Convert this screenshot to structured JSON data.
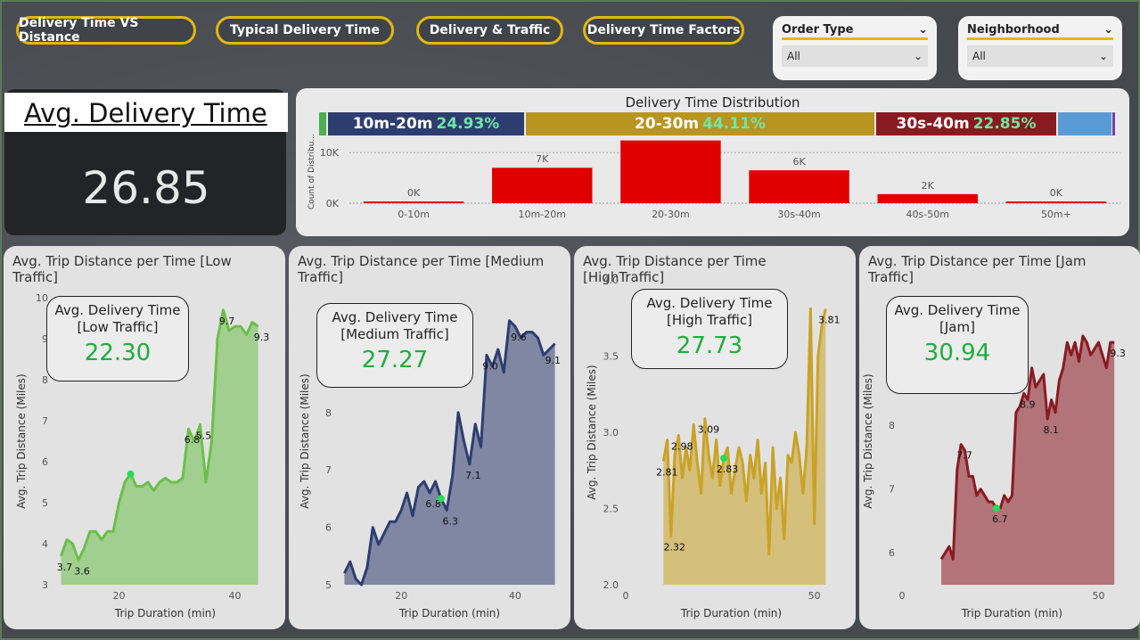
{
  "nav": {
    "btn1": "Delivery Time VS Distance",
    "btn2": "Typical Delivery Time",
    "btn3": "Delivery & Traffic",
    "btn4": "Delivery Time Factors"
  },
  "slicers": {
    "order_type": {
      "label": "Order Type",
      "value": "All"
    },
    "neighborhood": {
      "label": "Neighborhood",
      "value": "All"
    }
  },
  "kpi": {
    "label": "Avg. Delivery Time",
    "value": "26.85"
  },
  "distribution": {
    "title": "Delivery Time Distribution",
    "bands": [
      {
        "label": "10m-20m",
        "pct": "24.93%",
        "color": "#2e3d70"
      },
      {
        "label": "20-30m",
        "pct": "44.11%",
        "color": "#b8951f"
      },
      {
        "label": "30s-40m",
        "pct": "22.85%",
        "color": "#8a1a22"
      }
    ],
    "ylabel": "Count of Distribu...",
    "yticks": [
      "10K",
      "0K"
    ]
  },
  "panels": {
    "low": {
      "title": "Avg. Trip Distance per Time [Low Traffic]",
      "callout_label": "Avg. Delivery Time [Low Traffic]",
      "callout_value": "22.30"
    },
    "medium": {
      "title": "Avg. Trip Distance per Time [Medium Traffic]",
      "callout_label": "Avg. Delivery Time [Medium Traffic]",
      "callout_value": "27.27"
    },
    "high": {
      "title": "Avg. Trip Distance per Time [HighTraffic]",
      "callout_label": "Avg. Delivery Time [High Traffic]",
      "callout_value": "27.73"
    },
    "jam": {
      "title": "Avg. Trip Distance per Time [Jam Traffic]",
      "callout_label": "Avg. Delivery Time [Jam]",
      "callout_value": "30.94"
    }
  },
  "chart_data": [
    {
      "type": "bar",
      "title": "Delivery Time Distribution",
      "ylabel": "Count of Distribu...",
      "categories": [
        "0-10m",
        "10m-20m",
        "20-30m",
        "30s-40m",
        "40s-50m",
        "50m+"
      ],
      "values": [
        100,
        7000,
        12400,
        6500,
        1800,
        50
      ],
      "data_labels": [
        "0K",
        "7K",
        "",
        "6K",
        "2K",
        "0K"
      ],
      "ylim": [
        0,
        12500
      ],
      "color": "#e00000"
    },
    {
      "type": "area",
      "title": "Avg. Trip Distance per Time [Low Traffic]",
      "xlabel": "Trip Duration (min)",
      "ylabel": "Avg. Trip Distance (Miles)",
      "xlim": [
        9,
        47
      ],
      "ylim": [
        3,
        10
      ],
      "xticks": [
        20,
        40
      ],
      "yticks": [
        3,
        4,
        5,
        6,
        7,
        8,
        9,
        10
      ],
      "color": "#6cbf4a",
      "x": [
        10,
        11,
        12,
        13,
        14,
        15,
        16,
        17,
        18,
        19,
        20,
        21,
        22,
        23,
        24,
        25,
        26,
        27,
        28,
        29,
        30,
        31,
        32,
        33,
        34,
        35,
        36,
        37,
        38,
        39,
        40,
        41,
        42,
        43,
        44
      ],
      "y": [
        3.7,
        4.1,
        4.0,
        3.6,
        3.9,
        4.3,
        4.3,
        4.1,
        4.3,
        4.3,
        5.0,
        5.5,
        5.7,
        5.4,
        5.4,
        5.5,
        5.3,
        5.5,
        5.6,
        5.5,
        5.5,
        5.6,
        6.8,
        6.5,
        6.9,
        5.5,
        6.5,
        9.0,
        9.7,
        9.2,
        9.3,
        9.3,
        9.1,
        9.4,
        9.3
      ],
      "labels": [
        {
          "x": 10,
          "text": "3.7"
        },
        {
          "x": 13,
          "text": "3.6"
        },
        {
          "x": 32,
          "text": "6.8"
        },
        {
          "x": 34,
          "text": "5.5"
        },
        {
          "x": 38,
          "text": "9.7"
        },
        {
          "x": 44,
          "text": "9.3"
        }
      ],
      "marker_x": 22
    },
    {
      "type": "area",
      "title": "Avg. Trip Distance per Time [Medium Traffic]",
      "xlabel": "Trip Duration (min)",
      "ylabel": "Avg. Trip Distance (Miles)",
      "xlim": [
        9,
        48
      ],
      "ylim": [
        5,
        10
      ],
      "xticks": [
        20,
        40
      ],
      "yticks": [
        5,
        6,
        7,
        8,
        9
      ],
      "color": "#2e3d70",
      "x": [
        10,
        11,
        12,
        13,
        14,
        15,
        16,
        17,
        18,
        19,
        20,
        21,
        22,
        23,
        24,
        25,
        26,
        27,
        28,
        29,
        30,
        31,
        32,
        33,
        34,
        35,
        36,
        37,
        38,
        39,
        40,
        41,
        42,
        43,
        44,
        45,
        46,
        47
      ],
      "y": [
        5.2,
        5.4,
        5.1,
        5.0,
        5.3,
        6.0,
        5.7,
        5.9,
        6.1,
        6.1,
        6.3,
        6.6,
        6.2,
        6.7,
        6.8,
        6.6,
        6.8,
        6.5,
        6.3,
        6.9,
        8.0,
        7.5,
        7.1,
        7.8,
        7.4,
        9.0,
        8.8,
        9.1,
        8.7,
        9.6,
        9.5,
        9.3,
        9.4,
        9.4,
        9.3,
        9.0,
        9.1,
        9.2
      ],
      "labels": [
        {
          "x": 25,
          "text": "6.8"
        },
        {
          "x": 28,
          "text": "6.3"
        },
        {
          "x": 32,
          "text": "7.1"
        },
        {
          "x": 35,
          "text": "9.0"
        },
        {
          "x": 40,
          "text": "9.6"
        },
        {
          "x": 46,
          "text": "9.1"
        }
      ],
      "marker_x": 27
    },
    {
      "type": "area",
      "title": "Avg. Trip Distance per Time [HighTraffic]",
      "xlabel": "Trip Duration (min)",
      "ylabel": "Avg. Trip Distance (Miles)",
      "xlim": [
        0,
        56
      ],
      "ylim": [
        2.0,
        4.0
      ],
      "xticks": [
        0,
        50
      ],
      "yticks": [
        2.0,
        2.5,
        3.0,
        3.5,
        4.0
      ],
      "color": "#c9a227",
      "x": [
        10,
        11,
        12,
        13,
        14,
        15,
        16,
        17,
        18,
        19,
        20,
        21,
        22,
        23,
        24,
        25,
        26,
        27,
        28,
        29,
        30,
        31,
        32,
        33,
        34,
        35,
        36,
        37,
        38,
        39,
        40,
        41,
        42,
        43,
        44,
        45,
        46,
        47,
        48,
        49,
        50,
        51,
        52,
        53
      ],
      "y": [
        2.81,
        2.95,
        2.32,
        2.85,
        2.98,
        2.7,
        2.9,
        2.75,
        3.05,
        2.8,
        2.6,
        3.09,
        2.85,
        2.7,
        2.95,
        2.65,
        2.83,
        2.9,
        2.6,
        2.75,
        2.9,
        2.8,
        2.55,
        2.85,
        2.7,
        2.95,
        2.6,
        2.8,
        2.2,
        2.9,
        2.5,
        2.7,
        2.3,
        2.85,
        2.8,
        3.0,
        2.85,
        2.6,
        2.9,
        3.81,
        2.4,
        3.5,
        3.7,
        3.81
      ],
      "labels": [
        {
          "x": 10,
          "text": "2.81"
        },
        {
          "x": 12,
          "text": "2.32"
        },
        {
          "x": 14,
          "text": "2.98"
        },
        {
          "x": 21,
          "text": "3.09"
        },
        {
          "x": 26,
          "text": "2.83"
        },
        {
          "x": 53,
          "text": "3.81"
        }
      ],
      "marker_x": 26
    },
    {
      "type": "area",
      "title": "Avg. Trip Distance per Time [Jam Traffic]",
      "xlabel": "Trip Duration (min)",
      "ylabel": "Avg. Trip Distance (Miles)",
      "xlim": [
        0,
        56
      ],
      "ylim": [
        5.5,
        10
      ],
      "xticks": [
        0,
        50
      ],
      "yticks": [
        6,
        7,
        8,
        9
      ],
      "color": "#8a1a22",
      "x": [
        10,
        11,
        12,
        13,
        14,
        15,
        16,
        17,
        18,
        19,
        20,
        21,
        22,
        23,
        24,
        25,
        26,
        27,
        28,
        29,
        30,
        31,
        32,
        33,
        34,
        35,
        36,
        37,
        38,
        39,
        40,
        41,
        42,
        43,
        44,
        45,
        46,
        47,
        48,
        49,
        50,
        51,
        52,
        53,
        54
      ],
      "y": [
        5.9,
        6.0,
        6.1,
        5.9,
        7.3,
        7.7,
        7.6,
        7.2,
        7.2,
        6.9,
        7.0,
        6.9,
        6.8,
        6.8,
        6.7,
        6.7,
        6.9,
        6.8,
        6.9,
        8.2,
        8.3,
        8.5,
        8.4,
        8.9,
        8.6,
        8.7,
        8.8,
        8.1,
        8.4,
        8.2,
        8.7,
        8.9,
        9.3,
        9.1,
        9.3,
        9.0,
        9.4,
        9.3,
        9.1,
        9.2,
        9.3,
        9.1,
        8.9,
        9.3,
        9.3
      ],
      "labels": [
        {
          "x": 15,
          "text": "7.7"
        },
        {
          "x": 24,
          "text": "6.7"
        },
        {
          "x": 31,
          "text": "8.9"
        },
        {
          "x": 37,
          "text": "8.1"
        },
        {
          "x": 54,
          "text": "9.3"
        }
      ],
      "marker_x": 24
    }
  ]
}
